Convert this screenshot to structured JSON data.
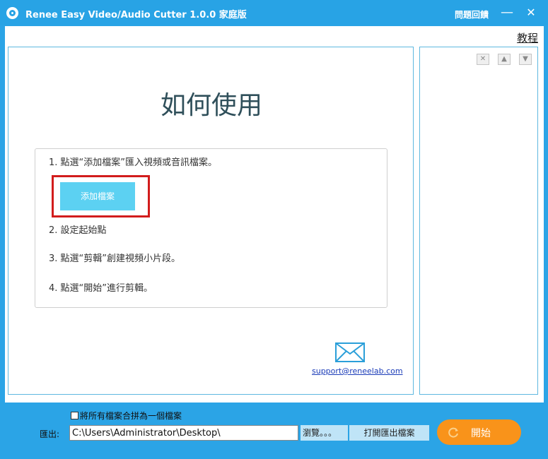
{
  "titlebar": {
    "title": "Renee Easy Video/Audio Cutter 1.0.0 家庭版",
    "feedback_label": "問題回饋",
    "minimize_symbol": "—",
    "close_symbol": "✕",
    "app_icon": "film-reel-icon"
  },
  "main": {
    "tutorial_label": "教程",
    "howto_title": "如何使用",
    "steps": [
      "1. 點選“添加檔案”匯入視頻或音訊檔案。",
      "2. 設定起始點",
      "3. 點選“剪輯”創建視頻小片段。",
      "4. 點選“開始”進行剪輯。"
    ],
    "add_file_label": "添加檔案",
    "support_email": "support@reneelab.com",
    "mail_icon": "envelope-icon"
  },
  "side_panel": {
    "remove_symbol": "✕",
    "up_symbol": "▲",
    "down_symbol": "▼"
  },
  "bottom": {
    "merge_label": "將所有檔案合拼為一個檔案",
    "merge_checked": false,
    "export_label": "匯出:",
    "export_path": "C:\\Users\\Administrator\\Desktop\\",
    "browse_label": "瀏覽。。。",
    "open_folder_label": "打開匯出檔案",
    "start_label": "開始",
    "start_icon": "refresh-icon"
  },
  "colors": {
    "window_blue": "#28a3e5",
    "highlight_red": "#d21c1c",
    "add_button": "#5cd1f2",
    "start_orange": "#f9931a",
    "secondary_button": "#bfe4f7"
  }
}
